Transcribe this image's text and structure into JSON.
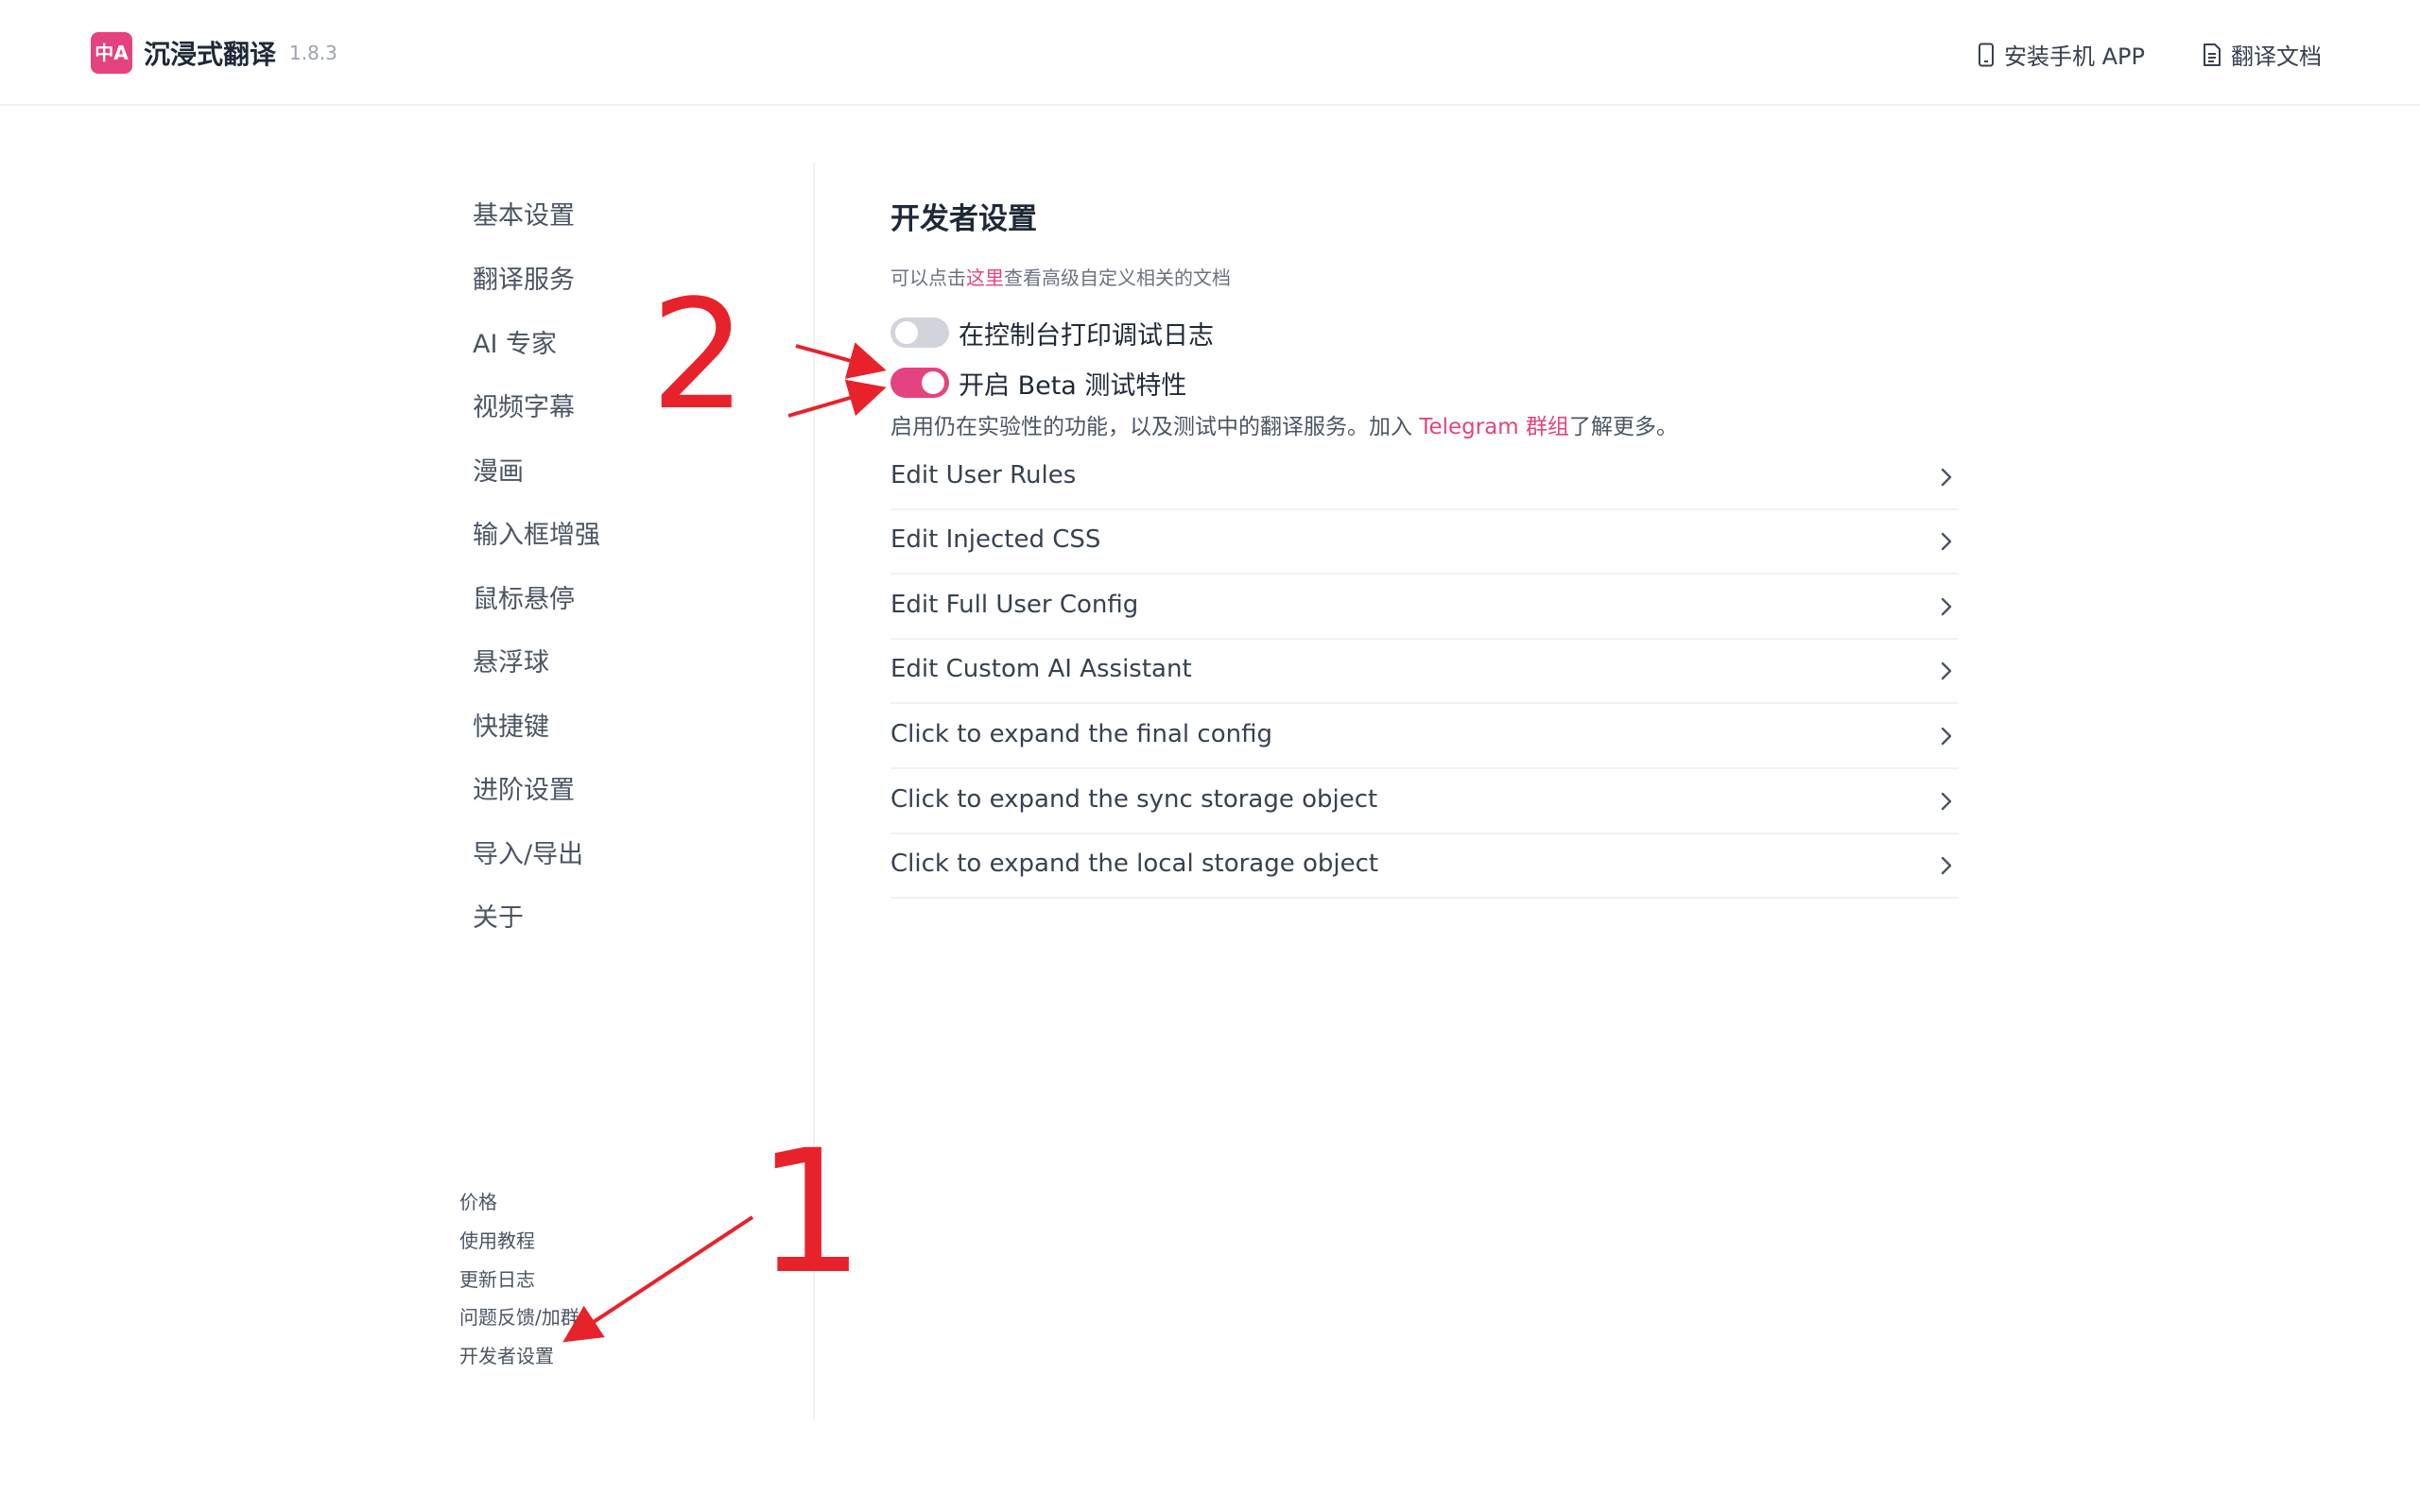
{
  "header": {
    "logo_text": "中A",
    "app_name": "沉浸式翻译",
    "version": "1.8.3",
    "install_app_label": "安装手机 APP",
    "docs_label": "翻译文档"
  },
  "sidebar": {
    "items": [
      {
        "label": "基本设置"
      },
      {
        "label": "翻译服务"
      },
      {
        "label": "AI 专家"
      },
      {
        "label": "视频字幕"
      },
      {
        "label": "漫画"
      },
      {
        "label": "输入框增强"
      },
      {
        "label": "鼠标悬停"
      },
      {
        "label": "悬浮球"
      },
      {
        "label": "快捷键"
      },
      {
        "label": "进阶设置"
      },
      {
        "label": "导入/导出"
      },
      {
        "label": "关于"
      }
    ],
    "footer": [
      {
        "label": "价格"
      },
      {
        "label": "使用教程"
      },
      {
        "label": "更新日志"
      },
      {
        "label": "问题反馈/加群"
      },
      {
        "label": "开发者设置"
      }
    ]
  },
  "main": {
    "title": "开发者设置",
    "subtitle_prefix": "可以点击",
    "subtitle_link": "这里",
    "subtitle_suffix": "查看高级自定义相关的文档",
    "toggles": [
      {
        "label": "在控制台打印调试日志",
        "state": "off"
      },
      {
        "label": "开启 Beta 测试特性",
        "state": "on"
      }
    ],
    "beta_desc_prefix": "启用仍在实验性的功能，以及测试中的翻译服务。加入 ",
    "beta_desc_link": "Telegram 群组",
    "beta_desc_suffix": "了解更多。",
    "rows": [
      {
        "label": "Edit User Rules"
      },
      {
        "label": "Edit Injected CSS"
      },
      {
        "label": "Edit Full User Config"
      },
      {
        "label": "Edit Custom AI Assistant"
      },
      {
        "label": "Click to expand the final config"
      },
      {
        "label": "Click to expand the sync storage object"
      },
      {
        "label": "Click to expand the local storage object"
      }
    ]
  },
  "annotations": {
    "marker_1": "1",
    "marker_2": "2",
    "color": "#e8222a"
  },
  "colors": {
    "accent": "#e4437f",
    "toggle_off": "#d1d5db"
  }
}
